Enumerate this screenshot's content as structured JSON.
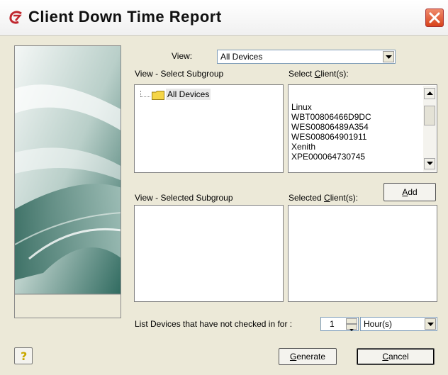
{
  "window": {
    "title": "Client Down Time Report"
  },
  "view": {
    "label": "View:",
    "value": "All Devices"
  },
  "select_subgroup": {
    "label": "View - Select Subgroup",
    "tree_root": "All Devices"
  },
  "select_clients": {
    "label_pre": "Select ",
    "label_mnemonic": "C",
    "label_post": "lient(s):",
    "items": [
      "Linux",
      "WBT00806466D9DC",
      "WES00806489A354",
      "WES008064901911",
      "Xenith",
      "XPE000064730745"
    ]
  },
  "selected_subgroup": {
    "label": "View - Selected Subgroup"
  },
  "selected_clients": {
    "label_pre": "Selected ",
    "label_mnemonic": "C",
    "label_post": "lient(s):"
  },
  "add_button": {
    "mnemonic": "A",
    "rest": "dd"
  },
  "list_devices": {
    "label": "List Devices that have not checked in for :",
    "value": "1",
    "unit": "Hour(s)"
  },
  "generate_button": {
    "mnemonic": "G",
    "rest": "enerate"
  },
  "cancel_button": {
    "mnemonic": "C",
    "rest": "ancel"
  },
  "help_button": {
    "icon": "help-question-icon",
    "glyph": "?"
  },
  "colors": {
    "close_red": "#d8421a",
    "folder_yellow": "#f5d547",
    "dialog_bg": "#ece9d8"
  }
}
